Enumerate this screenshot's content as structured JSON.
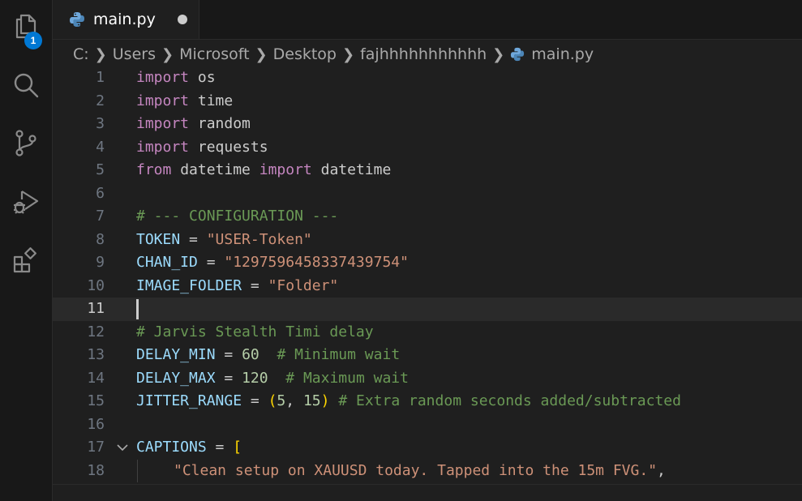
{
  "activity_bar": {
    "explorer_badge": "1"
  },
  "tab": {
    "label": "main.py"
  },
  "breadcrumb": [
    "C:",
    "Users",
    "Microsoft",
    "Desktop",
    "fajhhhhhhhhhhh",
    "main.py"
  ],
  "editor": {
    "current_line": 11,
    "lines": [
      {
        "n": "1",
        "tokens": [
          [
            "kw",
            "import"
          ],
          [
            "txt",
            " os"
          ]
        ]
      },
      {
        "n": "2",
        "tokens": [
          [
            "kw",
            "import"
          ],
          [
            "txt",
            " time"
          ]
        ]
      },
      {
        "n": "3",
        "tokens": [
          [
            "kw",
            "import"
          ],
          [
            "txt",
            " random"
          ]
        ]
      },
      {
        "n": "4",
        "tokens": [
          [
            "kw",
            "import"
          ],
          [
            "txt",
            " requests"
          ]
        ]
      },
      {
        "n": "5",
        "tokens": [
          [
            "kw",
            "from"
          ],
          [
            "txt",
            " datetime "
          ],
          [
            "kw",
            "import"
          ],
          [
            "txt",
            " datetime"
          ]
        ]
      },
      {
        "n": "6",
        "tokens": []
      },
      {
        "n": "7",
        "tokens": [
          [
            "cmt",
            "# --- CONFIGURATION ---"
          ]
        ]
      },
      {
        "n": "8",
        "tokens": [
          [
            "var",
            "TOKEN"
          ],
          [
            "txt",
            " = "
          ],
          [
            "str",
            "\"USER-Token\""
          ]
        ]
      },
      {
        "n": "9",
        "tokens": [
          [
            "var",
            "CHAN_ID"
          ],
          [
            "txt",
            " = "
          ],
          [
            "str",
            "\"1297596458337439754\""
          ]
        ]
      },
      {
        "n": "10",
        "tokens": [
          [
            "var",
            "IMAGE_FOLDER"
          ],
          [
            "txt",
            " = "
          ],
          [
            "str",
            "\"Folder\""
          ]
        ]
      },
      {
        "n": "11",
        "tokens": []
      },
      {
        "n": "12",
        "tokens": [
          [
            "cmt",
            "# Jarvis Stealth Timi delay"
          ]
        ]
      },
      {
        "n": "13",
        "tokens": [
          [
            "var",
            "DELAY_MIN"
          ],
          [
            "txt",
            " = "
          ],
          [
            "num",
            "60"
          ],
          [
            "txt",
            "  "
          ],
          [
            "cmt",
            "# Minimum wait"
          ]
        ]
      },
      {
        "n": "14",
        "tokens": [
          [
            "var",
            "DELAY_MAX"
          ],
          [
            "txt",
            " = "
          ],
          [
            "num",
            "120"
          ],
          [
            "txt",
            "  "
          ],
          [
            "cmt",
            "# Maximum wait"
          ]
        ]
      },
      {
        "n": "15",
        "tokens": [
          [
            "var",
            "JITTER_RANGE"
          ],
          [
            "txt",
            " = "
          ],
          [
            "br",
            "("
          ],
          [
            "num",
            "5"
          ],
          [
            "txt",
            ", "
          ],
          [
            "num",
            "15"
          ],
          [
            "br",
            ")"
          ],
          [
            "txt",
            " "
          ],
          [
            "cmt",
            "# Extra random seconds added/subtracted"
          ]
        ]
      },
      {
        "n": "16",
        "tokens": []
      },
      {
        "n": "17",
        "tokens": [
          [
            "var",
            "CAPTIONS"
          ],
          [
            "txt",
            " = "
          ],
          [
            "br",
            "["
          ]
        ]
      },
      {
        "n": "18",
        "tokens": [
          [
            "str",
            "\"Clean setup on XAUUSD today. Tapped into the 15m FVG.\""
          ],
          [
            "txt",
            ","
          ]
        ]
      }
    ]
  }
}
